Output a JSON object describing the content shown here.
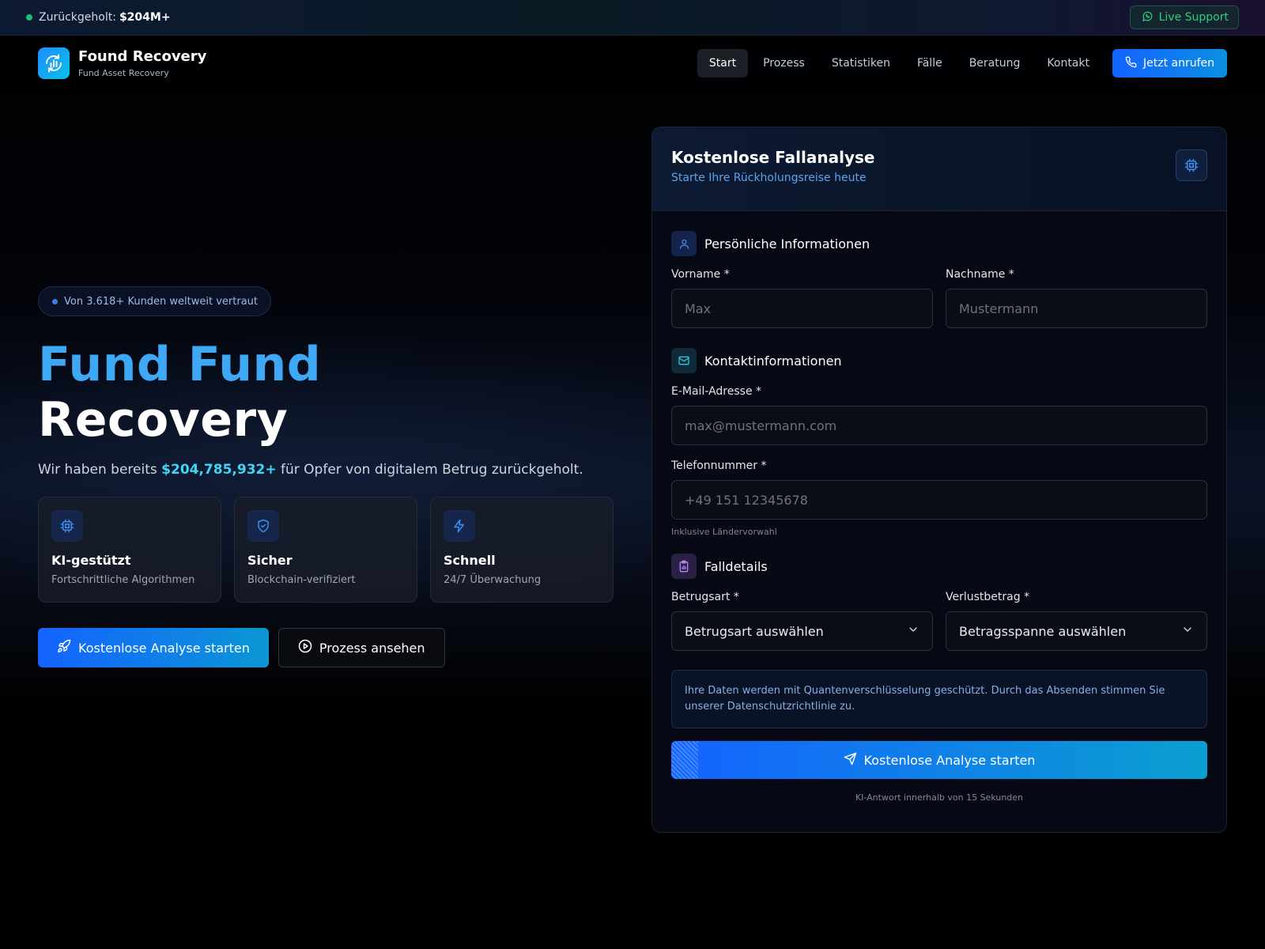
{
  "topbar": {
    "recovered_label": "Zurückgeholt:",
    "recovered_amount": "$204M+",
    "live_support": "Live Support"
  },
  "brand": {
    "name": "Found Recovery",
    "tagline": "Fund Asset Recovery"
  },
  "nav": {
    "links": [
      {
        "label": "Start",
        "active": true
      },
      {
        "label": "Prozess"
      },
      {
        "label": "Statistiken"
      },
      {
        "label": "Fälle"
      },
      {
        "label": "Beratung"
      },
      {
        "label": "Kontakt"
      }
    ],
    "call_button": "Jetzt anrufen"
  },
  "hero": {
    "badge": "Von 3.618+ Kunden weltweit vertraut",
    "title_line1": "Fund Fund",
    "title_line2": "Recovery",
    "text_before": "Wir haben bereits ",
    "text_amount": "$204,785,932+",
    "text_after": " für Opfer von digitalem Betrug zurückgeholt.",
    "features": [
      {
        "title": "KI-gestützt",
        "subtitle": "Fortschrittliche Algorithmen",
        "icon": "chip-icon"
      },
      {
        "title": "Sicher",
        "subtitle": "Blockchain-verifiziert",
        "icon": "shield-icon"
      },
      {
        "title": "Schnell",
        "subtitle": "24/7 Überwachung",
        "icon": "lightning-icon"
      }
    ],
    "cta_primary": "Kostenlose Analyse starten",
    "cta_secondary": "Prozess ansehen"
  },
  "form": {
    "title": "Kostenlose Fallanalyse",
    "subtitle": "Starte Ihre Rückholungsreise heute",
    "sections": {
      "personal": "Persönliche Informationen",
      "contact": "Kontaktinformationen",
      "case": "Falldetails"
    },
    "first_name": {
      "label": "Vorname *",
      "placeholder": "Max"
    },
    "last_name": {
      "label": "Nachname *",
      "placeholder": "Mustermann"
    },
    "email": {
      "label": "E-Mail-Adresse *",
      "placeholder": "max@mustermann.com"
    },
    "phone": {
      "label": "Telefonnummer *",
      "placeholder": "+49 151 12345678",
      "hint": "Inklusive Ländervorwahl"
    },
    "fraud_type": {
      "label": "Betrugsart *",
      "value": "Betrugsart auswählen"
    },
    "loss_amount": {
      "label": "Verlustbetrag *",
      "value": "Betragsspanne auswählen"
    },
    "notice": "Ihre Daten werden mit Quantenverschlüsselung geschützt. Durch das Absenden stimmen Sie unserer Datenschutzrichtlinie zu.",
    "submit": "Kostenlose Analyse starten",
    "footnote": "KI-Antwort innerhalb von 15 Sekunden"
  },
  "colors": {
    "accent_blue": "#1463ff",
    "accent_cyan": "#3fd6f6",
    "title_blue": "#3ea8f5",
    "success_green": "#27d07f"
  }
}
